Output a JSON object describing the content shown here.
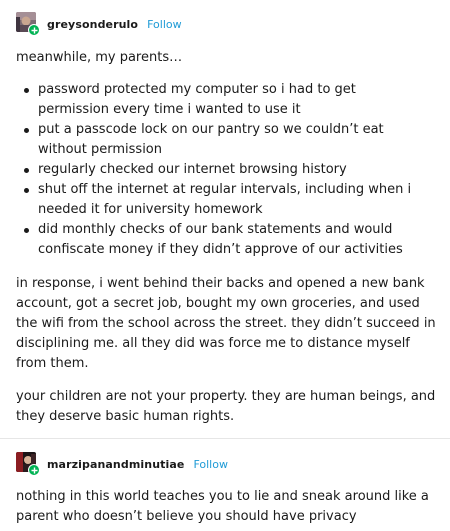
{
  "posts": [
    {
      "username": "greysonderulo",
      "follow_label": "Follow",
      "intro": "meanwhile, my parents…",
      "bullets": [
        "password protected my computer so i had to get permission every time i wanted to use it",
        "put a passcode lock on our pantry so we couldn’t eat without permission",
        "regularly checked our internet browsing history",
        "shut off the internet at regular intervals, including when i needed it for university homework",
        "did monthly checks of our bank statements and would confiscate money if they didn’t approve of our activities"
      ],
      "paragraphs": [
        "in response, i went behind their backs and opened a new bank account, got a secret job, bought my own groceries, and used the wifi from the school across the street. they didn’t succeed in disciplining me. all they did was force me to distance myself from them.",
        "your children are not your property. they are human beings, and they deserve basic human rights."
      ]
    },
    {
      "username": "marzipanandminutiae",
      "follow_label": "Follow",
      "body": "nothing in this world teaches you to lie and sneak around like a parent who doesn’t believe you should have privacy"
    }
  ],
  "colors": {
    "follow_link": "#1f9bd6",
    "follow_badge": "#00b253",
    "divider": "#e6e6e6",
    "text": "#1a1a1a"
  },
  "icons": {
    "follow_badge": "plus-icon",
    "avatar_1": "avatar-image",
    "avatar_2": "avatar-image"
  }
}
